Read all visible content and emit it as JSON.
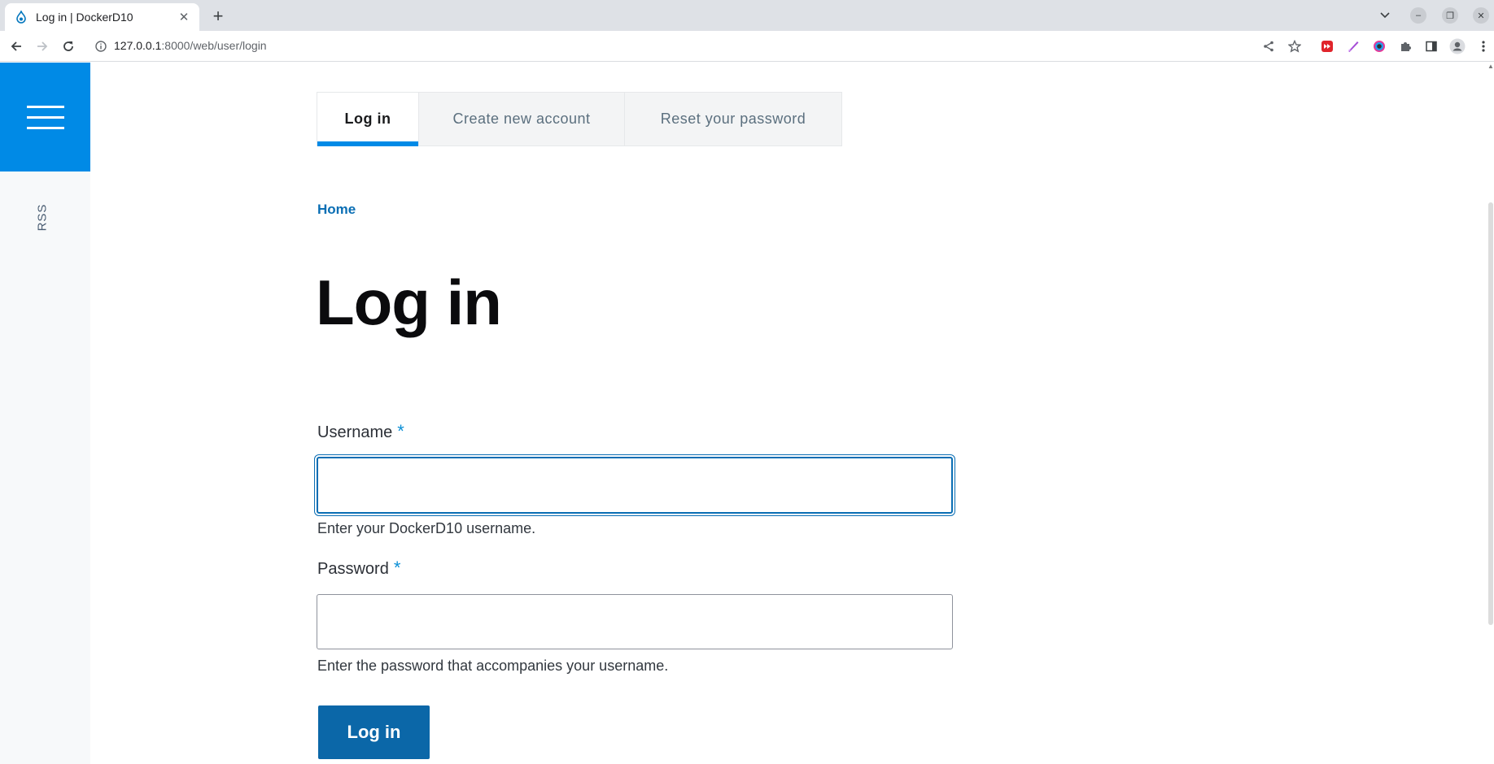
{
  "browser": {
    "tab_title": "Log in | DockerD10",
    "url_host": "127.0.0.1",
    "url_rest": ":8000/web/user/login",
    "icons": [
      "drupal-favicon-icon",
      "close-icon",
      "new-tab-icon",
      "back-icon",
      "forward-icon",
      "reload-icon",
      "site-info-icon",
      "share-icon",
      "bookmark-star-icon",
      "extension-red-icon",
      "extension-pen-icon",
      "extension-color-icon",
      "extensions-puzzle-icon",
      "side-panel-icon",
      "profile-icon",
      "more-menu-icon"
    ]
  },
  "sidebar": {
    "rss_label": "RSS"
  },
  "tabs": [
    {
      "label": "Log in",
      "active": true
    },
    {
      "label": "Create new account",
      "active": false
    },
    {
      "label": "Reset your password",
      "active": false
    }
  ],
  "breadcrumb": {
    "home": "Home"
  },
  "page_title": "Log in",
  "form": {
    "username_label": "Username",
    "username_required": "*",
    "username_value": "",
    "username_help": "Enter your DockerD10 username.",
    "password_label": "Password",
    "password_required": "*",
    "password_value": "",
    "password_help": "Enter the password that accompanies your username.",
    "submit_label": "Log in"
  },
  "colors": {
    "accent": "#008ae6",
    "link": "#0a6eb4",
    "button": "#0b67a8"
  }
}
